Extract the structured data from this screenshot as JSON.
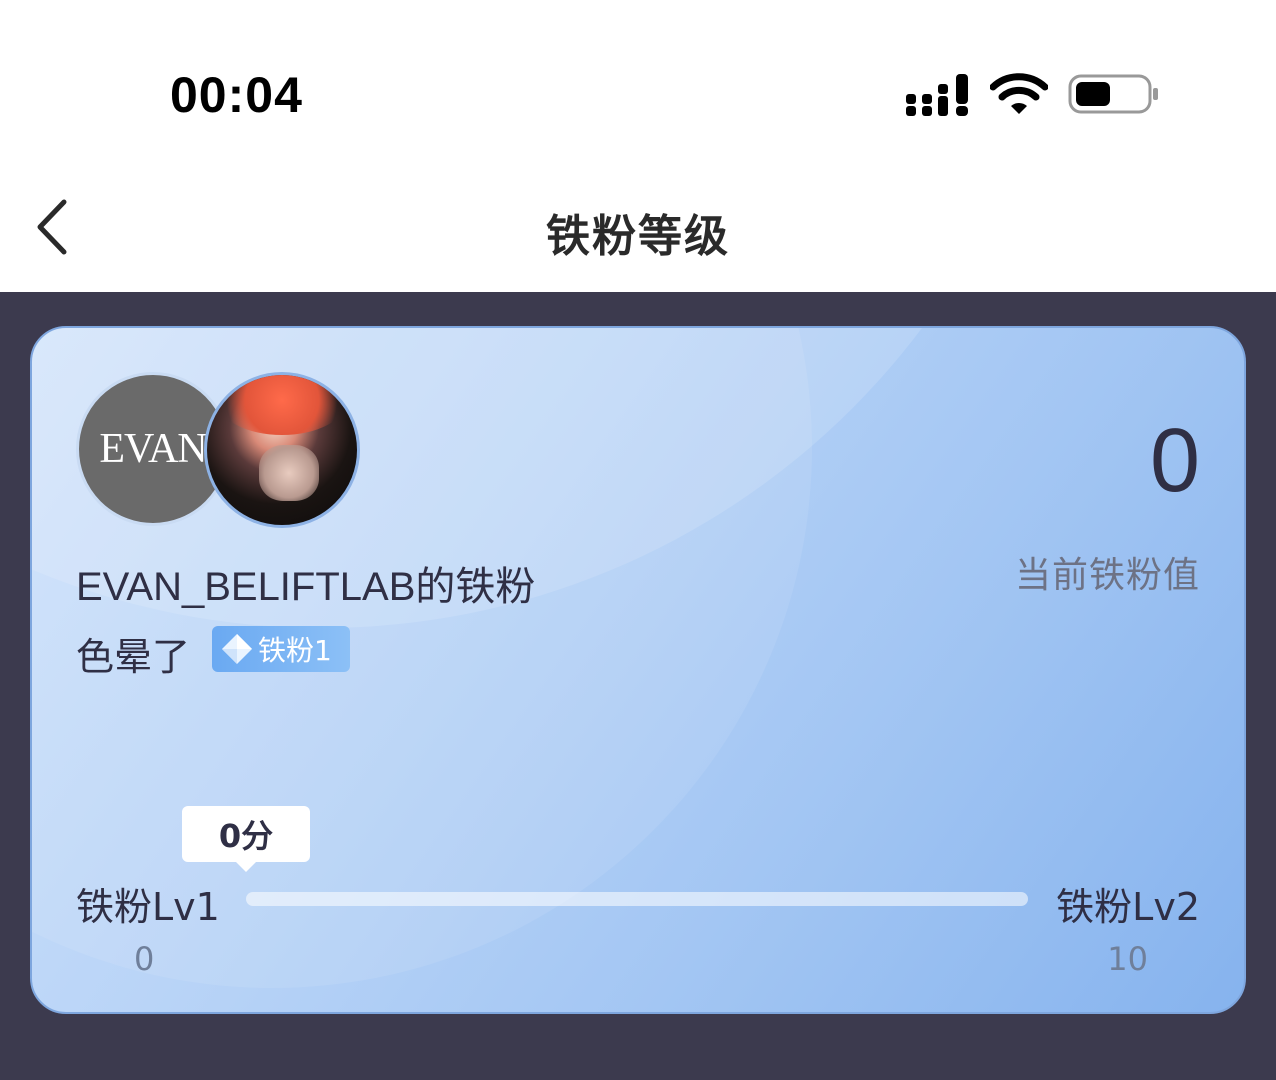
{
  "status": {
    "time": "00:04"
  },
  "nav": {
    "title": "铁粉等级"
  },
  "card": {
    "star_avatar_text": "EVAN",
    "username": "EVAN_BELIFTLAB的铁粉",
    "nickname": "色晕了",
    "badge": "铁粉1",
    "current_value": "0",
    "current_value_label": "当前铁粉值",
    "progress": {
      "score_bubble": "0分",
      "level_from": "铁粉Lv1",
      "level_to": "铁粉Lv2",
      "min": "0",
      "max": "10",
      "fraction": 0
    }
  },
  "colors": {
    "card_top": "#cfe2fb",
    "card_bottom": "#86b3ee",
    "page_bg": "#3c3a4e",
    "badge": "#6aa9f2"
  },
  "icons": [
    "back-icon",
    "signal-icon",
    "wifi-icon",
    "battery-icon",
    "diamond-icon"
  ]
}
